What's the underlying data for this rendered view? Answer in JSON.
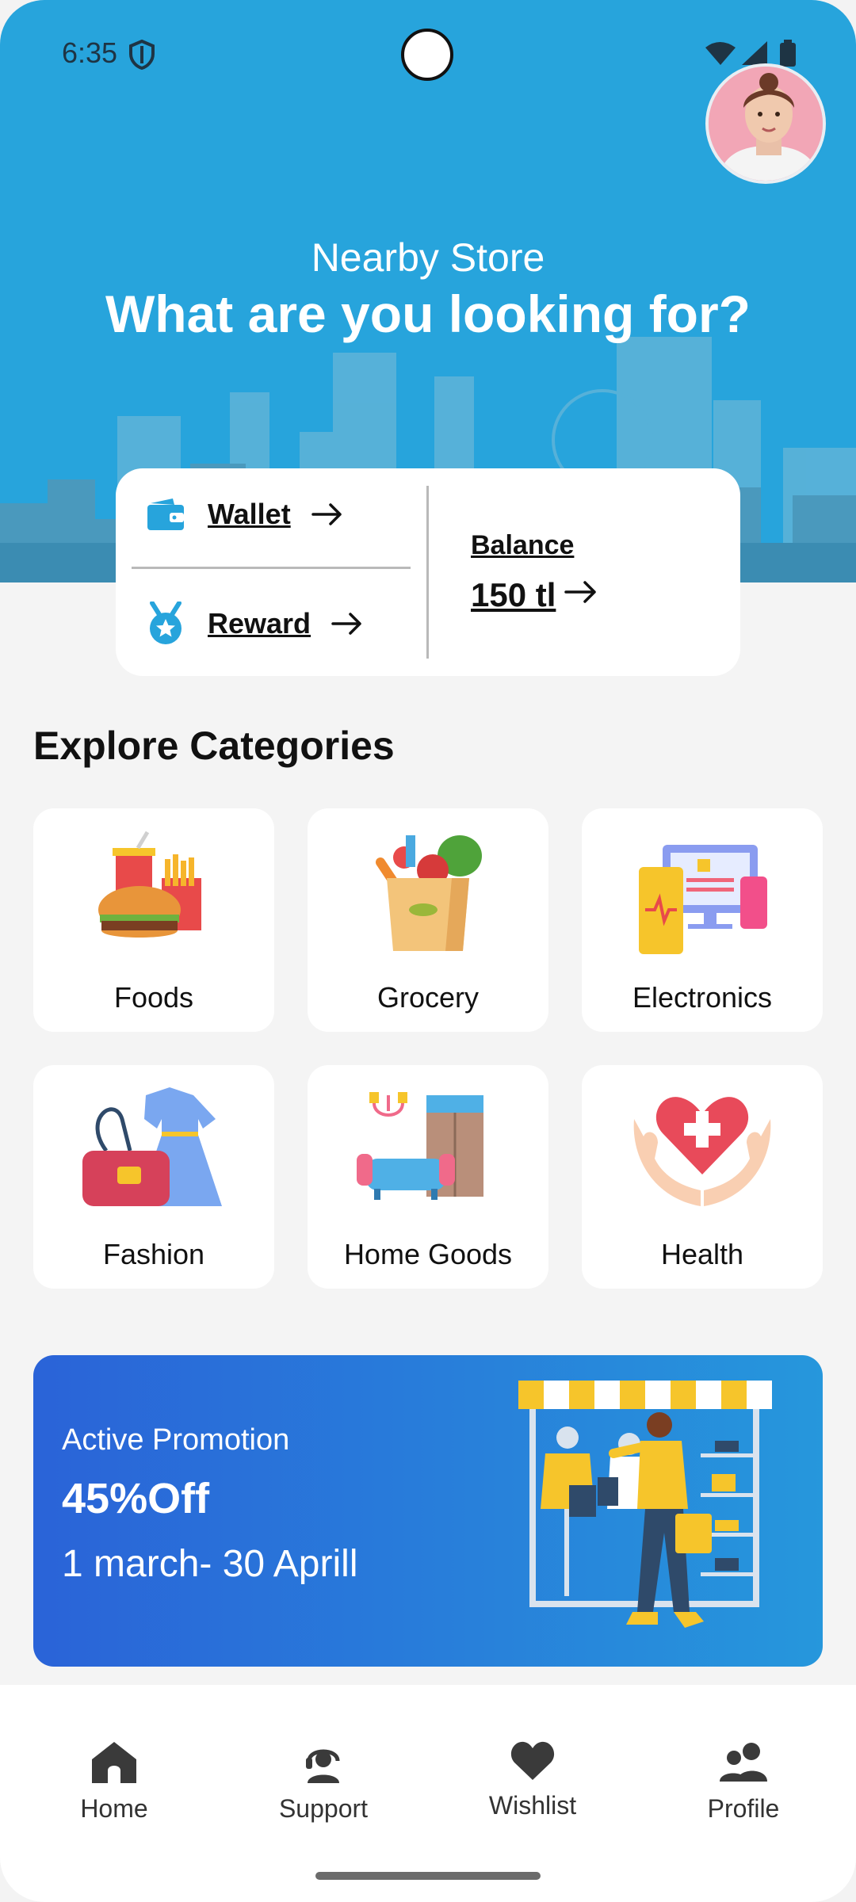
{
  "status_bar": {
    "time": "6:35"
  },
  "header": {
    "subtitle": "Nearby Store",
    "title": "What are you looking for?"
  },
  "wallet_card": {
    "wallet_label": "Wallet",
    "reward_label": "Reward",
    "balance_label": "Balance",
    "balance_value": "150 tl"
  },
  "categories": {
    "title": "Explore Categories",
    "items": [
      {
        "label": "Foods",
        "icon": "food-icon"
      },
      {
        "label": "Grocery",
        "icon": "grocery-bag-icon"
      },
      {
        "label": "Electronics",
        "icon": "electronics-icon"
      },
      {
        "label": "Fashion",
        "icon": "fashion-icon"
      },
      {
        "label": "Home Goods",
        "icon": "home-goods-icon"
      },
      {
        "label": "Health",
        "icon": "health-icon"
      }
    ]
  },
  "promotion": {
    "label": "Active Promotion",
    "offer": "45%Off",
    "dates": "1 march- 30 Aprill"
  },
  "bottom_nav": {
    "items": [
      {
        "label": "Home",
        "icon": "home-icon"
      },
      {
        "label": "Support",
        "icon": "support-icon"
      },
      {
        "label": "Wishlist",
        "icon": "heart-icon"
      },
      {
        "label": "Profile",
        "icon": "profile-icon"
      }
    ]
  },
  "colors": {
    "hero_blue": "#27a4dc",
    "promo_start": "#2a63d8",
    "promo_end": "#2697dc",
    "accent_yellow": "#f6c52b"
  }
}
